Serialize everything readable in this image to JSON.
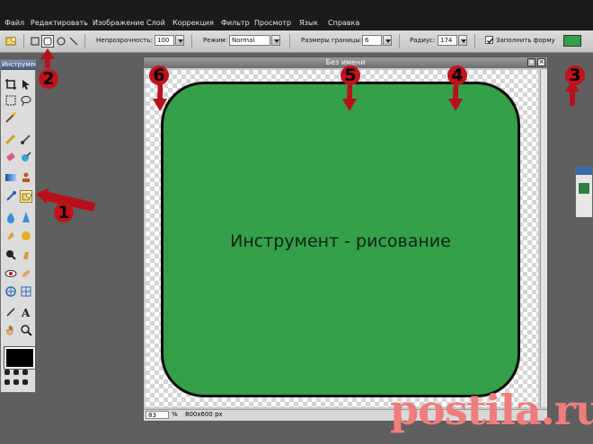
{
  "menu": [
    "Файл",
    "Редактировать",
    "Изображение",
    "Слой",
    "Коррекция",
    "Фильтр",
    "Просмотр",
    "Язык",
    "Справка"
  ],
  "options": {
    "opacity_label": "Непрозрачность:",
    "opacity_value": "100",
    "mode_label": "Режим:",
    "mode_value": "Normal",
    "border_label": "Размеры границы:",
    "border_value": "6",
    "radius_label": "Радиус:",
    "radius_value": "174",
    "fill_label": "Заполнить форму",
    "fill_checked": true,
    "fill_color": "#34a049"
  },
  "tools_panel": {
    "title": "Инструмен"
  },
  "document": {
    "title": "Без имени",
    "shape_text": "Инструмент - рисование",
    "zoom": "83",
    "zoom_unit": "%",
    "size": "800x600 px"
  },
  "annotations": [
    "1",
    "2",
    "3",
    "4",
    "5",
    "6"
  ],
  "watermark": "postila.ru",
  "colors": {
    "accent": "#c2121c",
    "fill_green": "#34a049",
    "watermark": "#f07d7d"
  }
}
